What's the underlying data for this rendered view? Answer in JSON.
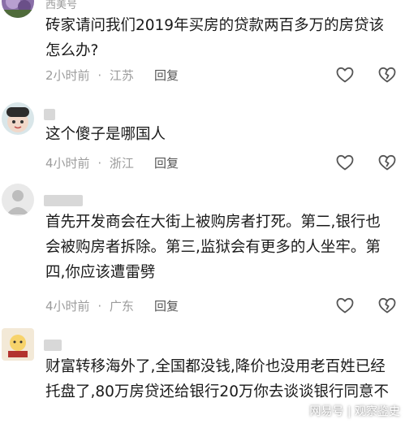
{
  "comments": [
    {
      "username": "西美号",
      "text": "砖家请问我们2019年买房的贷款两百多万的房贷该怎么办?",
      "time": "2小时前",
      "location": "江苏",
      "reply_label": "回复"
    },
    {
      "username": "",
      "text": "这个傻子是哪国人",
      "time": "4小时前",
      "location": "浙江",
      "reply_label": "回复"
    },
    {
      "username": "",
      "text": "首先开发商会在大街上被购房者打死。第二,银行也会被购房者拆除。第三,监狱会有更多的人坐牢。第四,你应该遭雷劈",
      "time": "4小时前",
      "location": "广东",
      "reply_label": "回复"
    },
    {
      "username": "",
      "text": "财富转移海外了,全国都没钱,降价也没用老百姓已经托盘了,80万房贷还给银行20万你去谈谈银行同意不",
      "time": "",
      "location": "",
      "reply_label": ""
    }
  ],
  "meta_separator": "·",
  "watermark": "网易号 | 观察鉴史",
  "icons": {
    "like": "heart-outline-icon",
    "dislike": "broken-heart-outline-icon"
  },
  "colors": {
    "text": "#1a1a1a",
    "meta": "#9c9c9c",
    "icon": "#555555"
  }
}
